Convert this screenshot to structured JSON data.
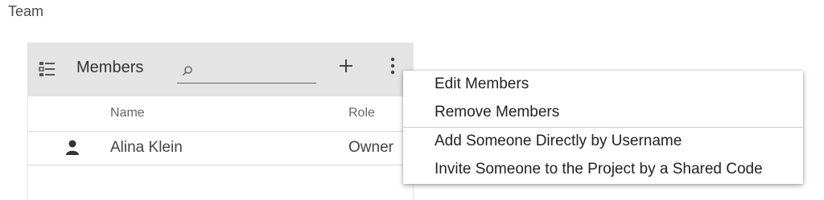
{
  "page": {
    "title": "Team"
  },
  "members_panel": {
    "title": "Members",
    "search": {
      "value": "",
      "placeholder": ""
    },
    "icons": {
      "list": "list-icon",
      "search": "search-icon",
      "add": "plus-icon",
      "more": "more-vertical-icon",
      "person": "person-icon"
    },
    "columns": [
      "Name",
      "Role"
    ],
    "rows": [
      {
        "name": "Alina Klein",
        "role": "Owner"
      }
    ]
  },
  "context_menu": {
    "items": [
      {
        "label": "Edit Members"
      },
      {
        "label": "Remove Members"
      },
      {
        "label": "Add Someone Directly by Username"
      },
      {
        "label": "Invite Someone to the Project by a Shared Code"
      }
    ]
  },
  "colors": {
    "toolbar_bg": "#e4e4e4",
    "text": "#333333",
    "menu_bg": "#ffffff"
  }
}
